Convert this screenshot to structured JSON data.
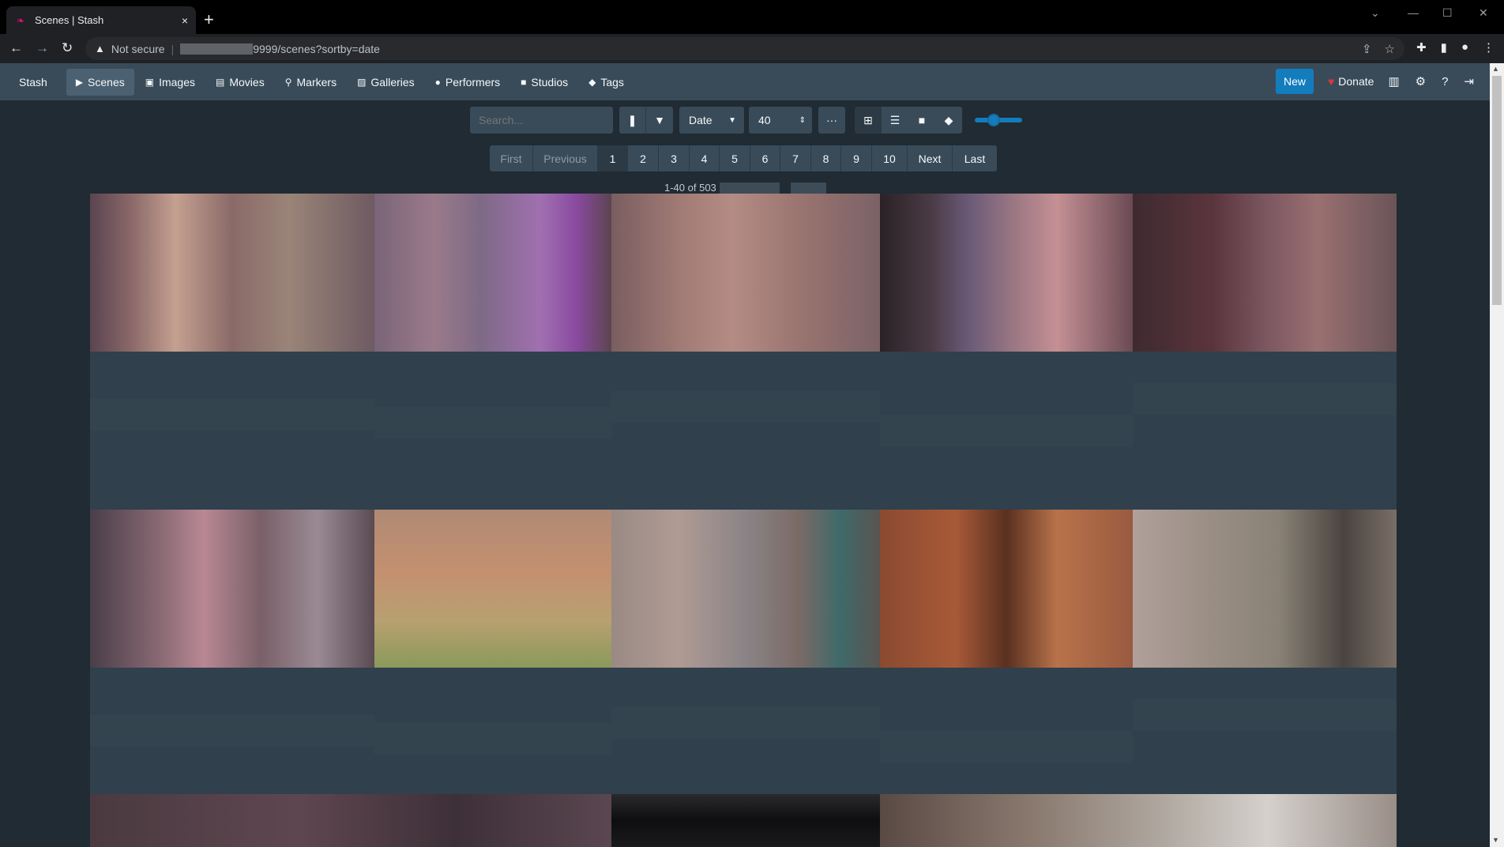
{
  "browser": {
    "tab_title": "Scenes | Stash",
    "tab_close": "×",
    "new_tab": "+",
    "security_label": "Not secure",
    "url": "9999/scenes?sortby=date",
    "icons": [
      "back-icon",
      "forward-icon",
      "reload-icon",
      "share-icon",
      "star-icon",
      "extensions-icon",
      "side-panel-icon",
      "profile-icon",
      "menu-icon"
    ]
  },
  "navbar": {
    "brand": "Stash",
    "items": [
      {
        "label": "Scenes",
        "icon": "play-circle-icon",
        "active": true
      },
      {
        "label": "Images",
        "icon": "image-icon",
        "active": false
      },
      {
        "label": "Movies",
        "icon": "film-icon",
        "active": false
      },
      {
        "label": "Markers",
        "icon": "map-marker-icon",
        "active": false
      },
      {
        "label": "Galleries",
        "icon": "images-icon",
        "active": false
      },
      {
        "label": "Performers",
        "icon": "user-icon",
        "active": false
      },
      {
        "label": "Studios",
        "icon": "video-icon",
        "active": false
      },
      {
        "label": "Tags",
        "icon": "tag-icon",
        "active": false
      }
    ],
    "new_label": "New",
    "donate_label": "Donate"
  },
  "toolbar": {
    "search_placeholder": "Search...",
    "sort_by": "Date",
    "per_page": "40",
    "more_label": "···"
  },
  "pagination": {
    "first": "First",
    "previous": "Previous",
    "pages": [
      "1",
      "2",
      "3",
      "4",
      "5",
      "6",
      "7",
      "8",
      "9",
      "10"
    ],
    "next": "Next",
    "last": "Last"
  },
  "results": {
    "count_text": "1-40 of 503"
  },
  "colors": {
    "accent": "#137cbd",
    "navbar_bg": "#394b59",
    "page_bg": "#202b33",
    "heart": "#db3737"
  }
}
